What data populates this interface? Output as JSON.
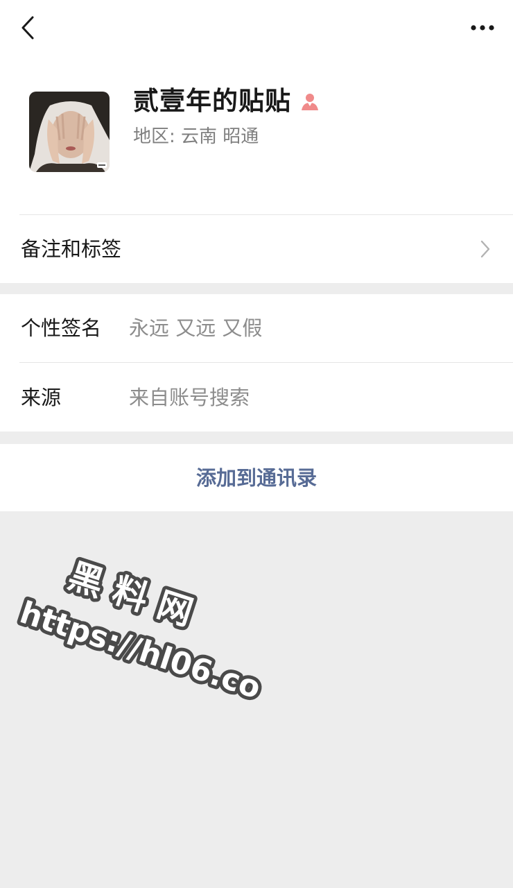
{
  "nav": {
    "back_icon": "chevron-left-icon",
    "more_icon": "more-horizontal-icon"
  },
  "profile": {
    "name": "贰壹年的贴贴",
    "gender_icon": "female-user-icon",
    "region_label": "地区:",
    "region_value": "云南 昭通"
  },
  "remarks_row": {
    "label": "备注和标签"
  },
  "signature_row": {
    "label": "个性签名",
    "value": "永远 又远 又假"
  },
  "source_row": {
    "label": "来源",
    "value": "来自账号搜索"
  },
  "action": {
    "add_contact_label": "添加到通讯录"
  },
  "watermark": {
    "line1": "黑 料 网",
    "line2": "https://hl06.co"
  },
  "colors": {
    "link": "#576b95",
    "background": "#ededed",
    "female_icon": "#f08a8a"
  }
}
